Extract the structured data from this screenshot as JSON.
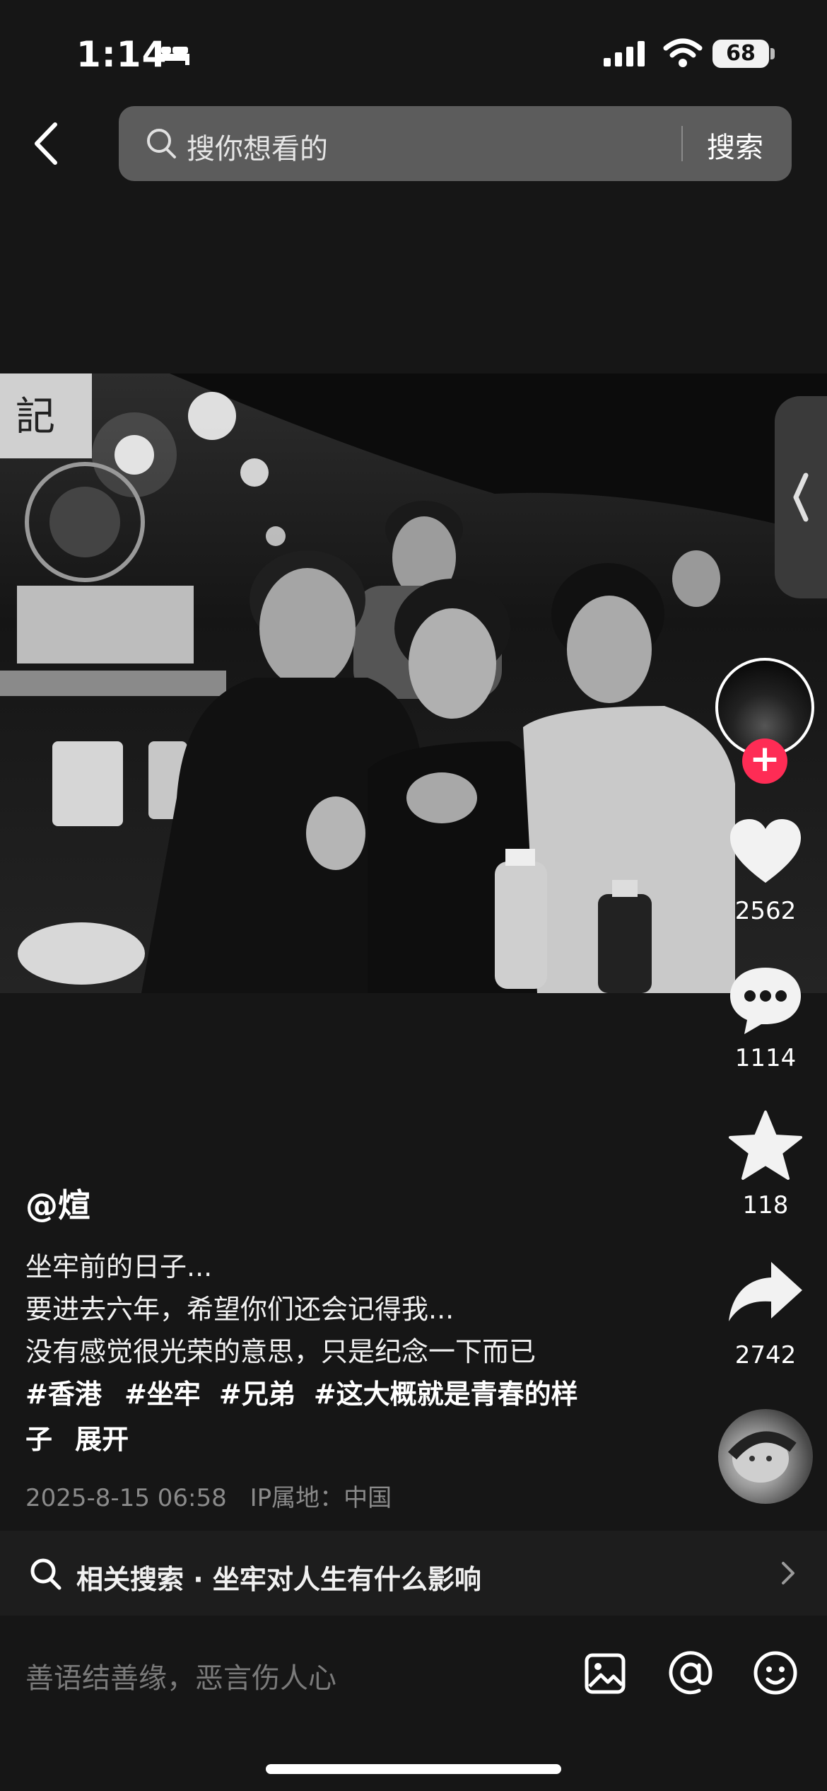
{
  "status_bar": {
    "time": "1:14",
    "battery": "68",
    "icons": [
      "bed-icon",
      "signal-icon",
      "wifi-icon",
      "battery-icon"
    ]
  },
  "top_nav": {
    "back_icon": "chevron-left-icon",
    "search_placeholder": "搜你想看的",
    "search_button": "搜索"
  },
  "rail": {
    "likes": "2562",
    "comments": "1114",
    "favorites": "118",
    "shares": "2742",
    "icons": [
      "heart-icon",
      "comment-icon",
      "star-icon",
      "share-icon"
    ]
  },
  "post": {
    "username": "@煊",
    "lines": [
      "坐牢前的日子...",
      "要进去六年，希望你们还会记得我...",
      "没有感觉很光荣的意思，只是纪念一下而已"
    ],
    "hashtags": [
      "#香港",
      "#坐牢",
      "#兄弟",
      "#这大概就是青春的样"
    ],
    "hashtag_tail": "子",
    "expand": "展开",
    "date": "2025-8-15 06:58",
    "ip_location": "IP属地：中国"
  },
  "related_search": {
    "text": "相关搜索 · 坐牢对人生有什么影响"
  },
  "comment_bar": {
    "placeholder": "善语结善缘，恶言伤人心",
    "icons": [
      "image-icon",
      "at-icon",
      "emoji-icon"
    ]
  },
  "colors": {
    "background": "#161616",
    "search_bg": "#5c5c5c",
    "follow_accent": "#fe2c55",
    "meta_text": "#8a8a8a"
  }
}
